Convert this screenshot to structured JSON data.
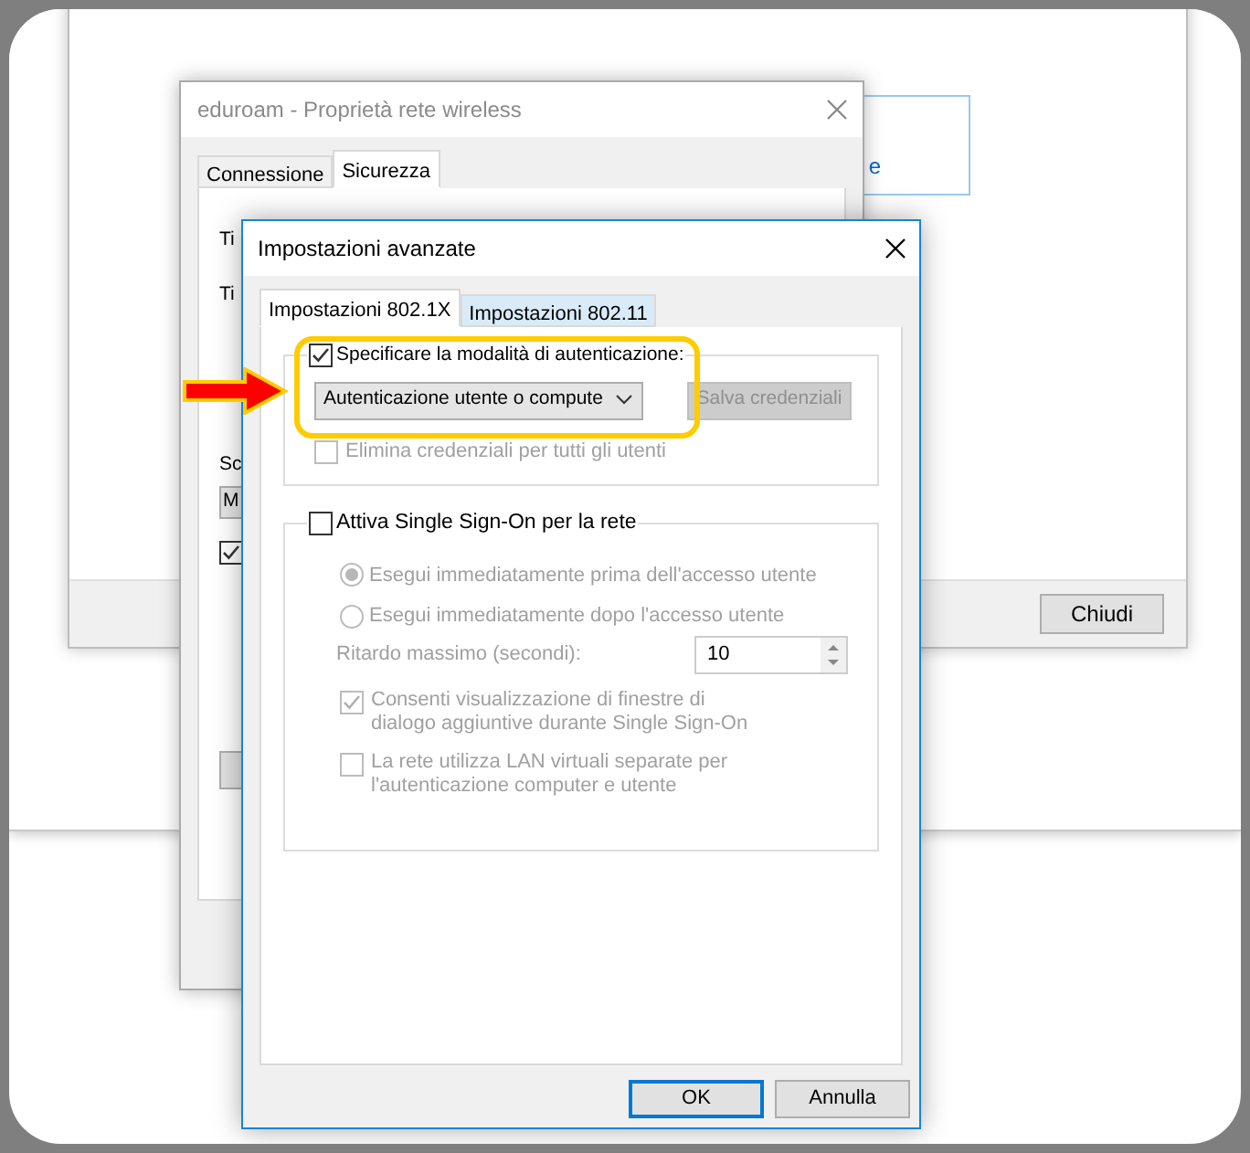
{
  "background_window": {
    "link_fragment": "e",
    "close_button": "Chiudi"
  },
  "wireless_window": {
    "title": "eduroam - Proprietà rete wireless",
    "tabs": [
      {
        "label": "Connessione",
        "selected": false
      },
      {
        "label": "Sicurezza",
        "selected": true
      }
    ],
    "label_fragments": [
      "Ti",
      "Ti",
      "Sc"
    ],
    "dropdown_fragment": "M",
    "checkbox_checked": true
  },
  "dialog": {
    "title": "Impostazioni avanzate",
    "tabs": [
      {
        "label": "Impostazioni 802.1X",
        "selected": true
      },
      {
        "label": "Impostazioni 802.11",
        "selected": false
      }
    ],
    "auth_group": {
      "checked": true,
      "label": "Specificare la modalità di autenticazione:",
      "mode": "Autenticazione utente o compute",
      "save_button": {
        "label": "Salva credenziali",
        "disabled": true
      },
      "delete_option": {
        "label": "Elimina credenziali per tutti gli utenti",
        "checked": false,
        "disabled": true
      }
    },
    "sso_group": {
      "checked": false,
      "label": "Attiva Single Sign-On per la rete",
      "disabled": true,
      "options": [
        {
          "label": "Esegui immediatamente prima dell'accesso utente",
          "selected": true
        },
        {
          "label": "Esegui immediatamente dopo l'accesso utente",
          "selected": false
        }
      ],
      "delay_label": "Ritardo massimo (secondi):",
      "delay_value": "10",
      "checkboxes": [
        {
          "label": "Consenti visualizzazione di finestre di dialogo aggiuntive durante Single Sign-On",
          "checked": true
        },
        {
          "label": "La rete utilizza LAN virtuali separate per l'autenticazione computer e utente",
          "checked": false
        }
      ]
    },
    "buttons": [
      {
        "label": "OK",
        "default": true
      },
      {
        "label": "Annulla",
        "default": false
      }
    ]
  }
}
